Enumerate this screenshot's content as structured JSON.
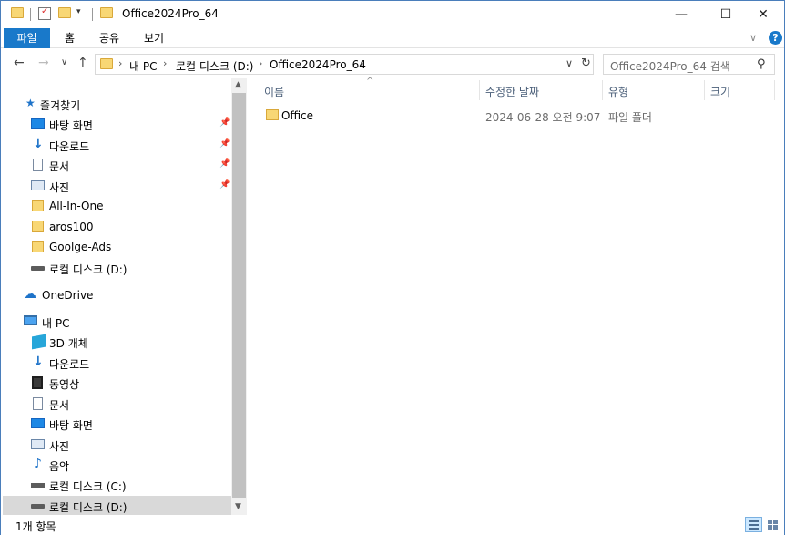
{
  "window": {
    "title": "Office2024Pro_64",
    "minimize_glyph": "—",
    "maximize_glyph": "☐",
    "close_glyph": "✕"
  },
  "ribbon": {
    "tabs": [
      "파일",
      "홈",
      "공유",
      "보기"
    ],
    "expand_glyph": "∨",
    "help_glyph": "?"
  },
  "nav": {
    "back_glyph": "←",
    "forward_glyph": "→",
    "recent_glyph": "∨",
    "up_glyph": "↑",
    "breadcrumb": [
      "내 PC",
      "로컬 디스크 (D:)",
      "Office2024Pro_64"
    ],
    "crumb_sep": "›",
    "dropdown_glyph": "∨",
    "refresh_glyph": "↻"
  },
  "search": {
    "placeholder": "Office2024Pro_64 검색",
    "icon_glyph": "⚲"
  },
  "sidebar": {
    "quick_access": "즐겨찾기",
    "quick_items": [
      {
        "label": "바탕 화면",
        "icon": "desktop-icon",
        "pinned": true
      },
      {
        "label": "다운로드",
        "icon": "download-icon",
        "pinned": true
      },
      {
        "label": "문서",
        "icon": "document-icon",
        "pinned": true
      },
      {
        "label": "사진",
        "icon": "pictures-icon",
        "pinned": true
      },
      {
        "label": "All-In-One",
        "icon": "folder-icon",
        "pinned": false
      },
      {
        "label": "aros100",
        "icon": "folder-icon",
        "pinned": false
      },
      {
        "label": "Goolge-Ads",
        "icon": "folder-icon",
        "pinned": false
      },
      {
        "label": "로컬 디스크 (D:)",
        "icon": "drive-icon",
        "pinned": false
      }
    ],
    "onedrive": "OneDrive",
    "this_pc": "내 PC",
    "pc_items": [
      {
        "label": "3D 개체",
        "icon": "3d-objects-icon"
      },
      {
        "label": "다운로드",
        "icon": "download-icon"
      },
      {
        "label": "동영상",
        "icon": "video-icon"
      },
      {
        "label": "문서",
        "icon": "document-icon"
      },
      {
        "label": "바탕 화면",
        "icon": "desktop-icon"
      },
      {
        "label": "사진",
        "icon": "pictures-icon"
      },
      {
        "label": "음악",
        "icon": "music-icon"
      },
      {
        "label": "로컬 디스크 (C:)",
        "icon": "system-drive-icon"
      },
      {
        "label": "로컬 디스크 (D:)",
        "icon": "drive-icon",
        "selected": true
      }
    ],
    "pin_glyph": "📌",
    "star_glyph": "★",
    "cloud_glyph": "☁",
    "download_glyph": "↓",
    "music_glyph": "♪"
  },
  "columns": {
    "name": "이름",
    "date": "수정한 날짜",
    "type": "유형",
    "size": "크기",
    "sort_glyph": "^"
  },
  "files": [
    {
      "name": "Office",
      "date": "2024-06-28 오전 9:07",
      "type": "파일 폴더",
      "size": ""
    }
  ],
  "scrollbar": {
    "up_glyph": "▲",
    "down_glyph": "▼"
  },
  "status": {
    "item_count": "1개 항목"
  },
  "colors": {
    "accent": "#1979ca",
    "selection": "#cce8ff",
    "folder": "#f8d775"
  }
}
